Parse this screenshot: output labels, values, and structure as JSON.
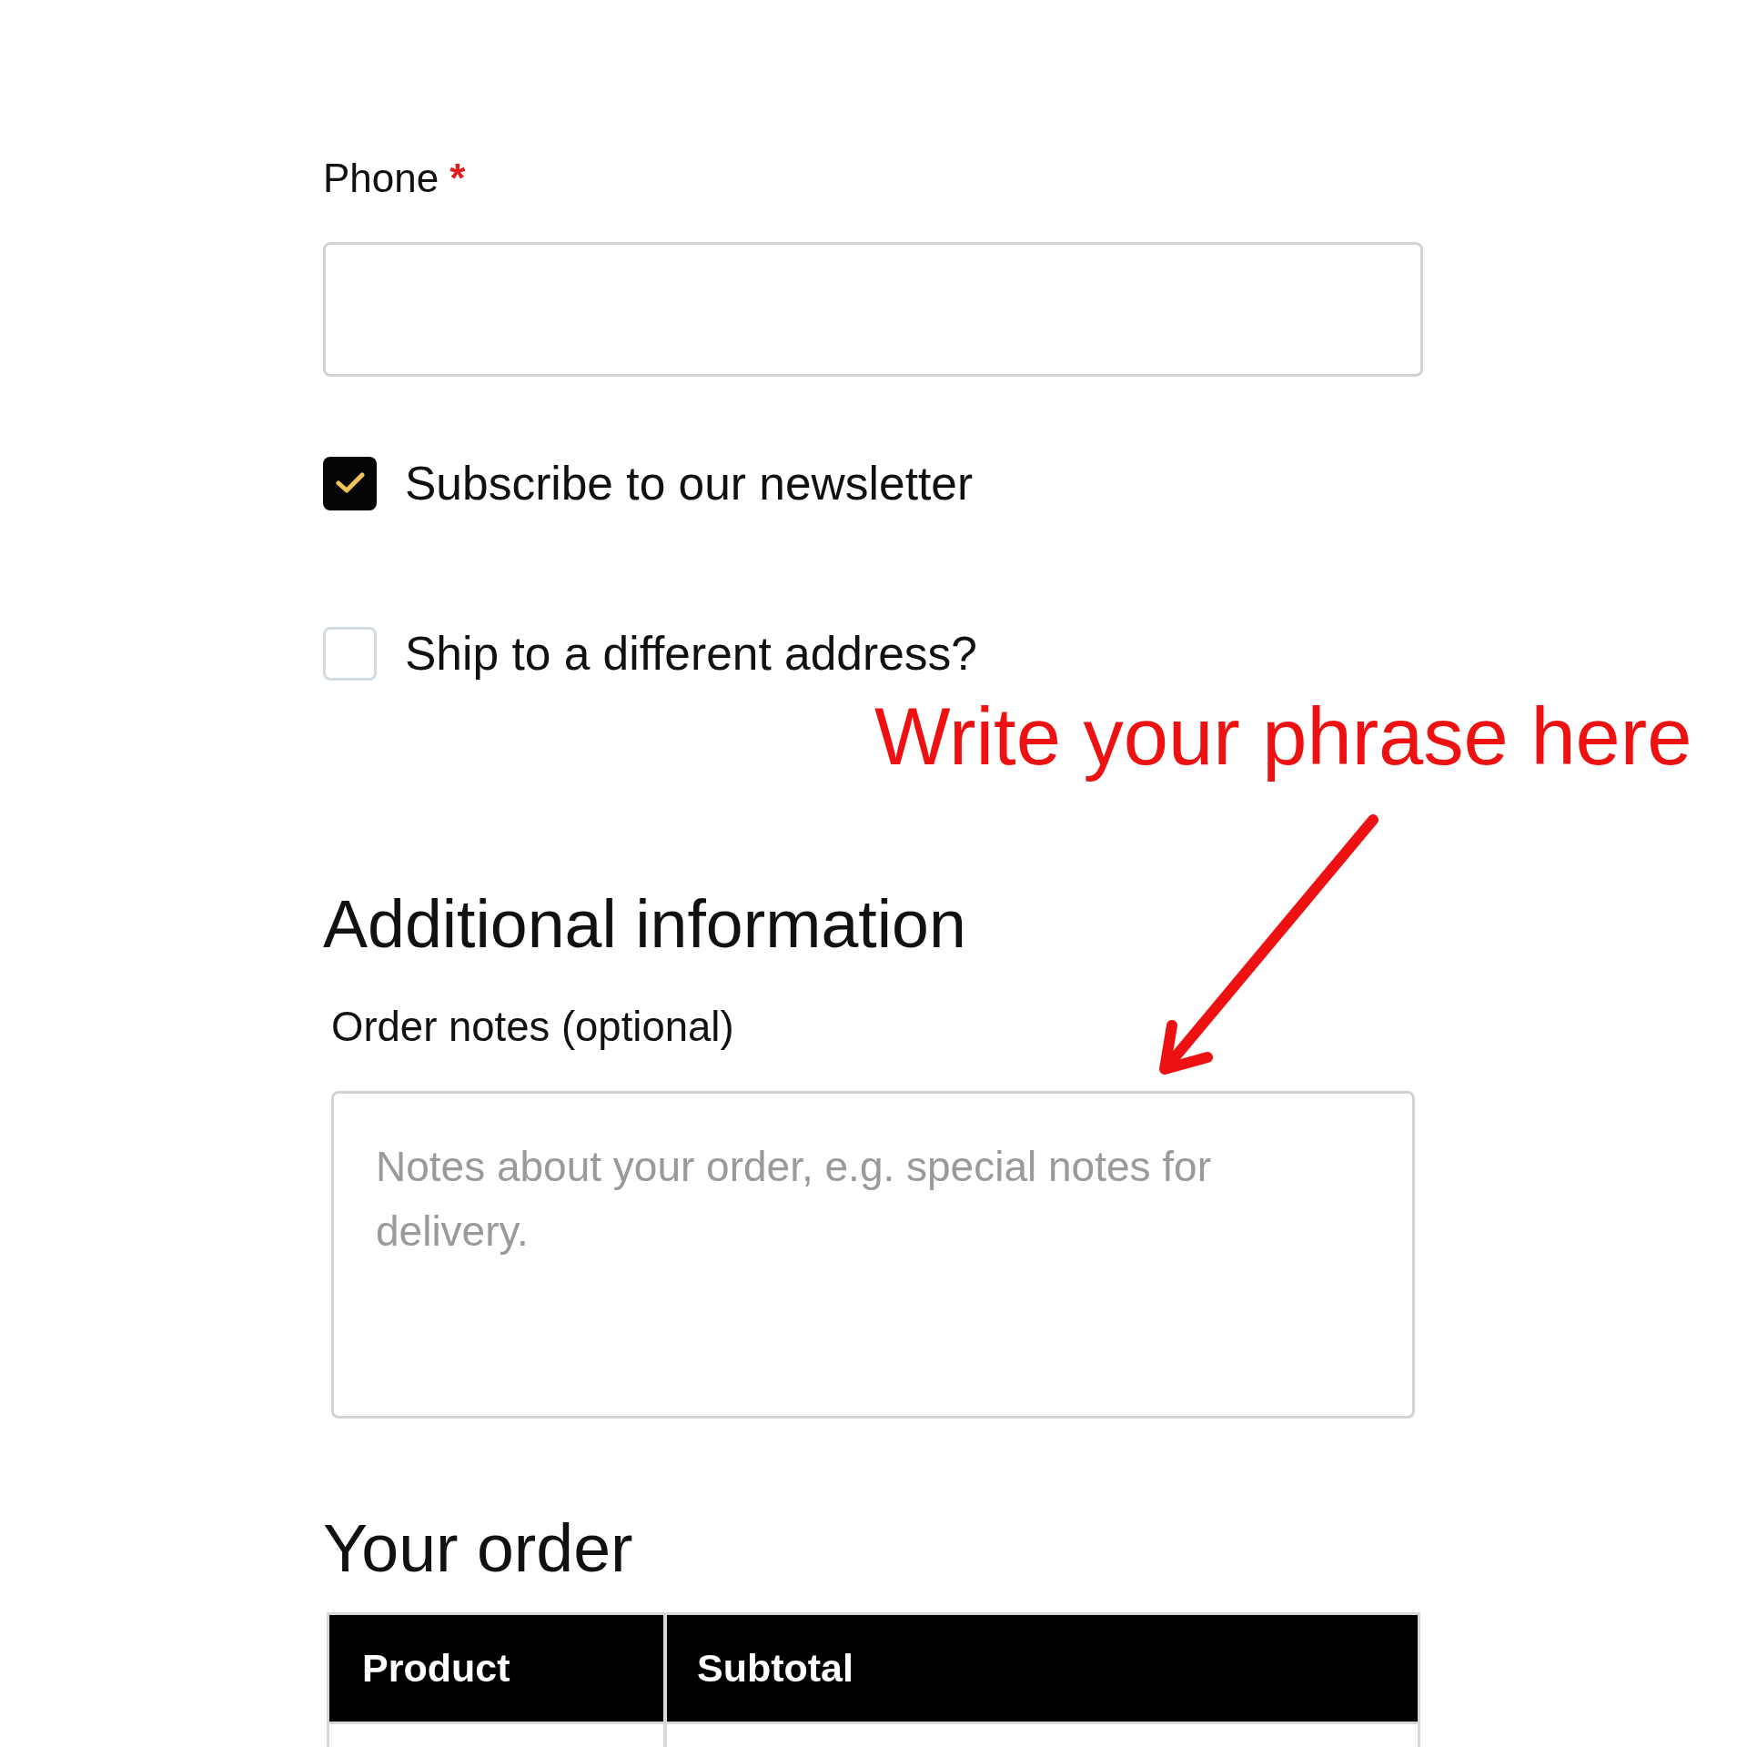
{
  "phone_field": {
    "label": "Phone",
    "required_mark": "*"
  },
  "checkboxes": [
    {
      "label": "Subscribe to our newsletter",
      "checked": true
    },
    {
      "label": "Ship to a different address?",
      "checked": false
    }
  ],
  "annotation": {
    "text": "Write your phrase here"
  },
  "additional_information": {
    "heading": "Additional information",
    "order_notes": {
      "label": "Order notes (optional)",
      "placeholder": "Notes about your order, e.g. special notes for delivery."
    }
  },
  "your_order": {
    "heading": "Your order",
    "table": {
      "columns": [
        "Product",
        "Subtotal"
      ]
    }
  }
}
